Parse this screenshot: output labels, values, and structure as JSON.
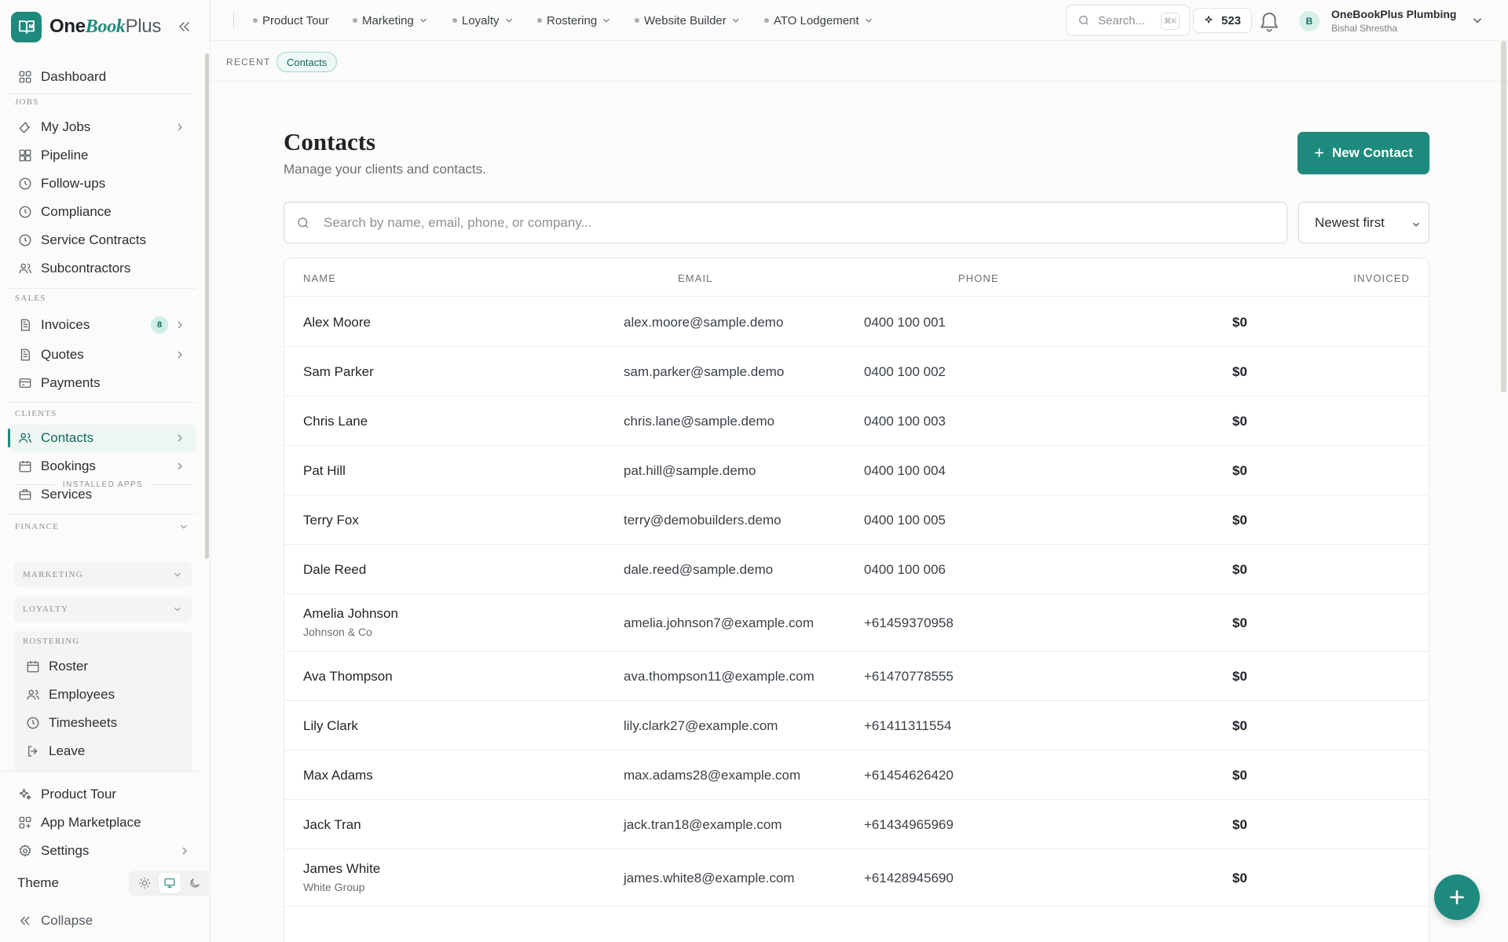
{
  "brand": {
    "one": "One",
    "book": "Book",
    "plus": "Plus"
  },
  "sidebar": {
    "dashboard": "Dashboard",
    "sections": {
      "jobs": "JOBS",
      "sales": "SALES",
      "clients": "CLIENTS",
      "finance": "FINANCE",
      "installed": "INSTALLED APPS"
    },
    "jobs": [
      "My Jobs",
      "Pipeline",
      "Follow-ups",
      "Compliance",
      "Service Contracts",
      "Subcontractors"
    ],
    "sales": {
      "invoices": "Invoices",
      "invoices_badge": "8",
      "quotes": "Quotes",
      "payments": "Payments"
    },
    "clients": {
      "contacts": "Contacts",
      "bookings": "Bookings",
      "services": "Services"
    },
    "groups": {
      "marketing": "MARKETING",
      "loyalty": "LOYALTY",
      "rostering": "ROSTERING"
    },
    "rostering": [
      "Roster",
      "Employees",
      "Timesheets",
      "Leave"
    ],
    "bottom": {
      "tour": "Product Tour",
      "marketplace": "App Marketplace",
      "settings": "Settings",
      "theme": "Theme",
      "collapse": "Collapse"
    }
  },
  "topbar": {
    "menus": [
      "Product Tour",
      "Marketing",
      "Loyalty",
      "Rostering",
      "Website Builder",
      "ATO Lodgement"
    ],
    "search_placeholder": "Search...",
    "search_kbd": "⌘K",
    "credits": "523",
    "account_name": "OneBookPlus Plumbing",
    "account_user": "Bishal Shrestha",
    "avatar_letter": "B"
  },
  "recent": {
    "label": "RECENT",
    "chip": "Contacts"
  },
  "page": {
    "title": "Contacts",
    "subtitle": "Manage your clients and contacts.",
    "new_button": "New Contact",
    "search_placeholder": "Search by name, email, phone, or company...",
    "sort": "Newest first"
  },
  "table": {
    "headers": {
      "name": "NAME",
      "email": "EMAIL",
      "phone": "PHONE",
      "invoiced": "INVOICED"
    },
    "rows": [
      {
        "name": "Alex Moore",
        "company": "",
        "email": "alex.moore@sample.demo",
        "phone": "0400 100 001",
        "invoiced": "$0"
      },
      {
        "name": "Sam Parker",
        "company": "",
        "email": "sam.parker@sample.demo",
        "phone": "0400 100 002",
        "invoiced": "$0"
      },
      {
        "name": "Chris Lane",
        "company": "",
        "email": "chris.lane@sample.demo",
        "phone": "0400 100 003",
        "invoiced": "$0"
      },
      {
        "name": "Pat Hill",
        "company": "",
        "email": "pat.hill@sample.demo",
        "phone": "0400 100 004",
        "invoiced": "$0"
      },
      {
        "name": "Terry Fox",
        "company": "",
        "email": "terry@demobuilders.demo",
        "phone": "0400 100 005",
        "invoiced": "$0"
      },
      {
        "name": "Dale Reed",
        "company": "",
        "email": "dale.reed@sample.demo",
        "phone": "0400 100 006",
        "invoiced": "$0"
      },
      {
        "name": "Amelia Johnson",
        "company": "Johnson & Co",
        "email": "amelia.johnson7@example.com",
        "phone": "+61459370958",
        "invoiced": "$0"
      },
      {
        "name": "Ava Thompson",
        "company": "",
        "email": "ava.thompson11@example.com",
        "phone": "+61470778555",
        "invoiced": "$0"
      },
      {
        "name": "Lily Clark",
        "company": "",
        "email": "lily.clark27@example.com",
        "phone": "+61411311554",
        "invoiced": "$0"
      },
      {
        "name": "Max Adams",
        "company": "",
        "email": "max.adams28@example.com",
        "phone": "+61454626420",
        "invoiced": "$0"
      },
      {
        "name": "Jack Tran",
        "company": "",
        "email": "jack.tran18@example.com",
        "phone": "+61434965969",
        "invoiced": "$0"
      },
      {
        "name": "James White",
        "company": "White Group",
        "email": "james.white8@example.com",
        "phone": "+61428945690",
        "invoiced": "$0"
      }
    ]
  },
  "colors": {
    "accent": "#1e8a7d",
    "accent_dark": "#14695f",
    "accent_light": "#eef6f4"
  }
}
